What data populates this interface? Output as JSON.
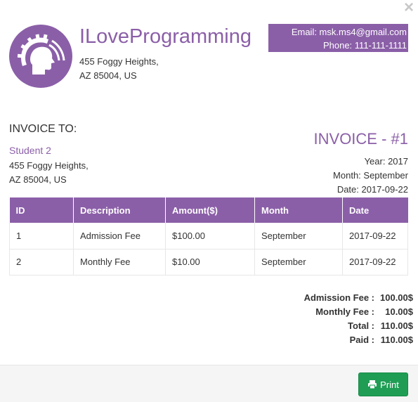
{
  "modal": {
    "close_glyph": "×"
  },
  "company": {
    "name": "ILoveProgramming",
    "address_line1": "455 Foggy Heights,",
    "address_line2": "AZ 85004, US",
    "email": "Email: msk.ms4@gmail.com",
    "phone": "Phone: 111-111-1111"
  },
  "invoice_to": {
    "label": "INVOICE TO:",
    "name": "Student 2",
    "address_line1": "455 Foggy Heights,",
    "address_line2": "AZ 85004, US"
  },
  "invoice": {
    "title": "INVOICE - #1",
    "year": "Year: 2017",
    "month": "Month: September",
    "date": "Date: 2017-09-22"
  },
  "table": {
    "headers": [
      "ID",
      "Description",
      "Amount($)",
      "Month",
      "Date"
    ],
    "rows": [
      [
        "1",
        "Admission Fee",
        "$100.00",
        "September",
        "2017-09-22"
      ],
      [
        "2",
        "Monthly Fee",
        "$10.00",
        "September",
        "2017-09-22"
      ]
    ]
  },
  "totals": [
    {
      "label": "Admission Fee :",
      "value": "100.00$"
    },
    {
      "label": "Monthly Fee :",
      "value": "10.00$"
    },
    {
      "label": "Total :",
      "value": "110.00$"
    },
    {
      "label": "Paid :",
      "value": "110.00$"
    }
  ],
  "footer": {
    "print_label": "Print"
  },
  "colors": {
    "brand": "#8b5fa8",
    "print_button": "#1f9d55"
  },
  "icons": {
    "close": "close-icon",
    "logo": "logo-gear-head-icon",
    "print": "printer-icon"
  }
}
